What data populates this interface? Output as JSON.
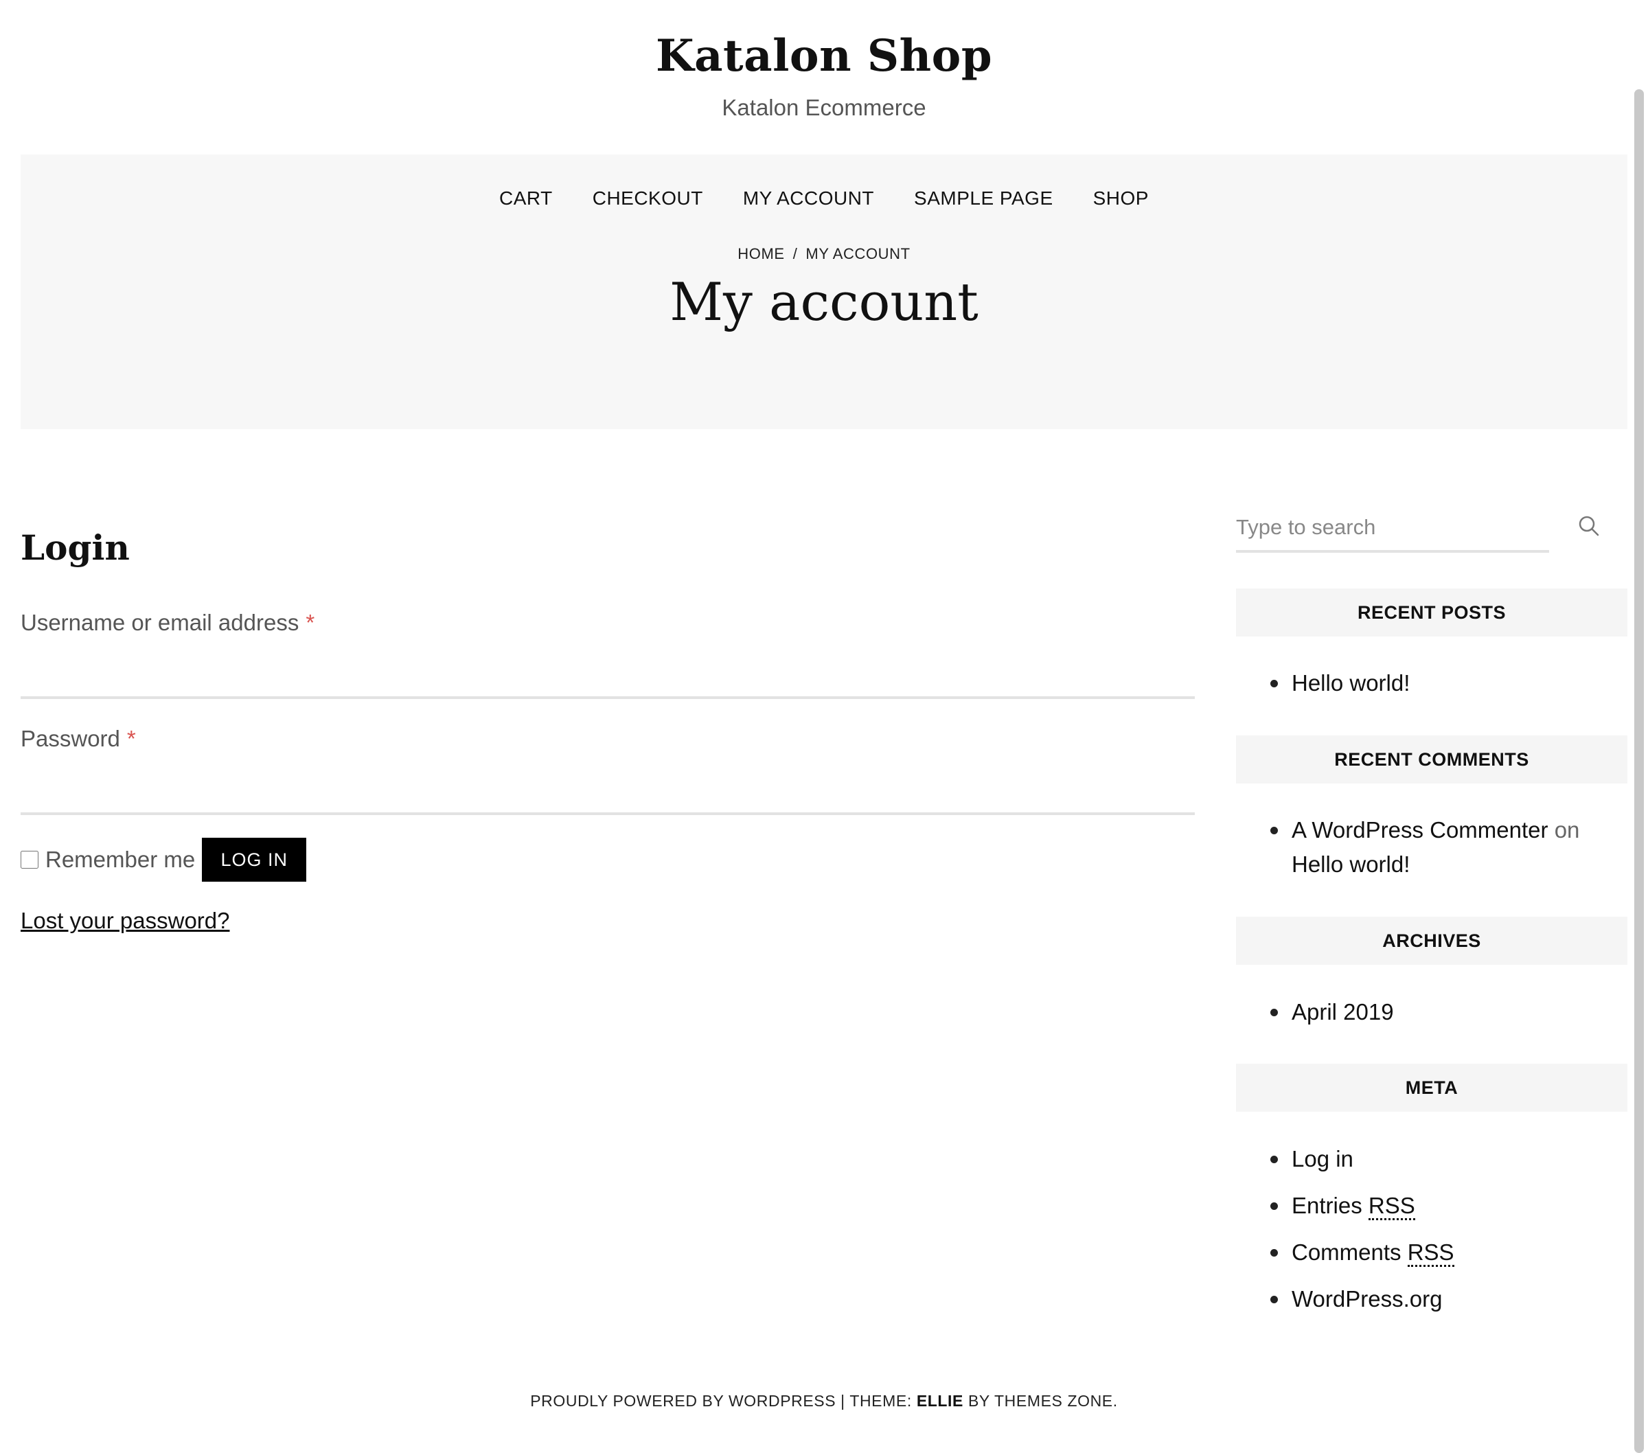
{
  "header": {
    "site_title": "Katalon Shop",
    "tagline": "Katalon Ecommerce"
  },
  "nav": {
    "items": [
      "CART",
      "CHECKOUT",
      "MY ACCOUNT",
      "SAMPLE PAGE",
      "SHOP"
    ]
  },
  "breadcrumb": {
    "home": "HOME",
    "separator": "/",
    "current": "MY ACCOUNT"
  },
  "page_title": "My account",
  "login": {
    "heading": "Login",
    "username_label": "Username or email address",
    "username_value": "",
    "password_label": "Password",
    "password_value": "",
    "required_mark": "*",
    "remember_label": "Remember me",
    "remember_checked": false,
    "button_label": "LOG IN",
    "lost_password": "Lost your password?"
  },
  "sidebar": {
    "search_placeholder": "Type to search",
    "recent_posts": {
      "heading": "RECENT POSTS",
      "items": [
        "Hello world!"
      ]
    },
    "recent_comments": {
      "heading": "RECENT COMMENTS",
      "author": "A WordPress Commenter",
      "connector": "on",
      "post": "Hello world!"
    },
    "archives": {
      "heading": "ARCHIVES",
      "items": [
        "April 2019"
      ]
    },
    "meta": {
      "heading": "META",
      "log_in": "Log in",
      "entries_prefix": "Entries",
      "comments_prefix": "Comments",
      "rss": "RSS",
      "wordpress_org": "WordPress.org"
    }
  },
  "footer": {
    "prefix": "PROUDLY POWERED BY WORDPRESS | THEME:",
    "theme_name": "ELLIE",
    "suffix": "BY THEMES ZONE."
  },
  "colors": {
    "hero_background": "#f7f7f7",
    "widget_background": "#f5f5f5",
    "required": "#d9534f",
    "button_background": "#000000"
  }
}
